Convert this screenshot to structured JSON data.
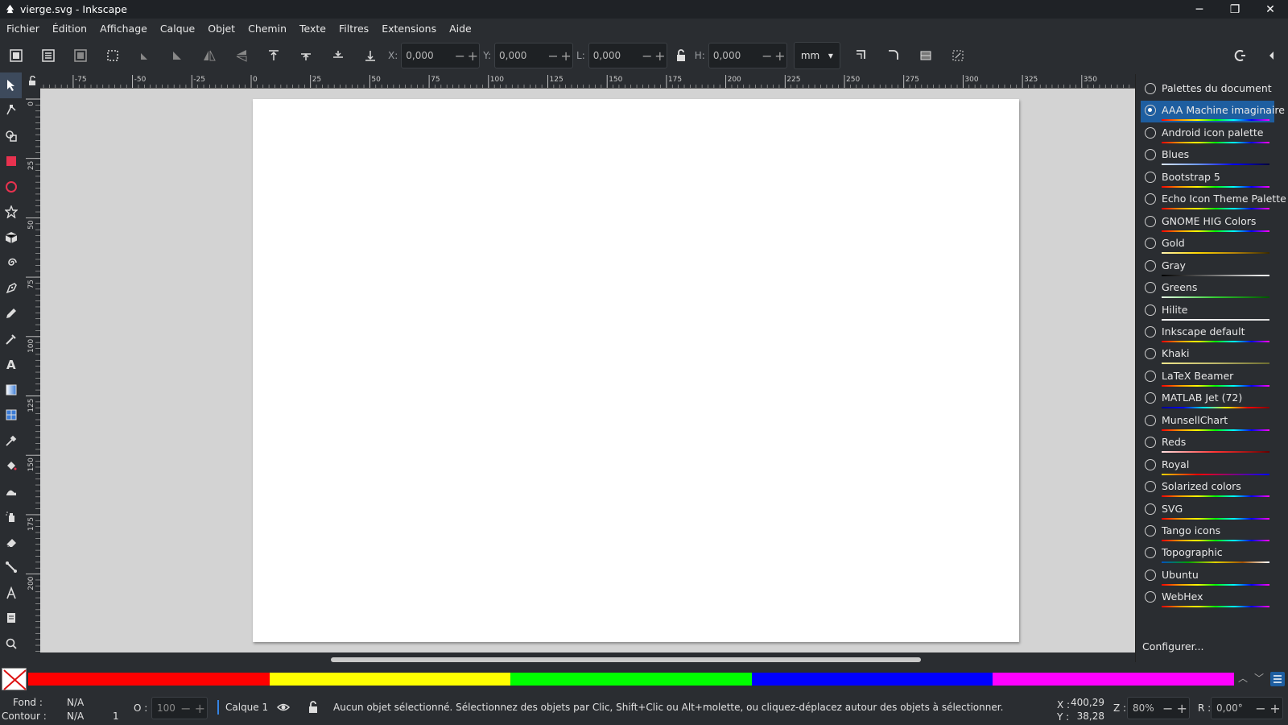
{
  "window": {
    "title": "vierge.svg - Inkscape"
  },
  "menu": [
    "Fichier",
    "Édition",
    "Affichage",
    "Calque",
    "Objet",
    "Chemin",
    "Texte",
    "Filtres",
    "Extensions",
    "Aide"
  ],
  "toolbar": {
    "x_label": "X:",
    "x_value": "0,000",
    "y_label": "Y:",
    "y_value": "0,000",
    "w_label": "L:",
    "w_value": "0,000",
    "h_label": "H:",
    "h_value": "0,000",
    "unit": "mm"
  },
  "rulers": {
    "top_ticks": [
      "-75",
      "-50",
      "-25",
      "0",
      "25",
      "50",
      "75",
      "100",
      "125",
      "150",
      "175",
      "200",
      "225",
      "250",
      "275",
      "300",
      "325",
      "350"
    ],
    "left_ticks": [
      "0",
      "25",
      "50",
      "75",
      "100",
      "125",
      "150",
      "175",
      "200"
    ]
  },
  "palettes": {
    "items": [
      {
        "name": "Palettes du document",
        "selected": false,
        "swatch": "none"
      },
      {
        "name": "AAA Machine imaginaire",
        "selected": true,
        "swatch": "rainbow"
      },
      {
        "name": "Android icon palette",
        "selected": false,
        "swatch": "rainbow"
      },
      {
        "name": "Blues",
        "selected": false,
        "swatch": "blues"
      },
      {
        "name": "Bootstrap 5",
        "selected": false,
        "swatch": "rainbow"
      },
      {
        "name": "Echo Icon Theme Palette",
        "selected": false,
        "swatch": "rainbow"
      },
      {
        "name": "GNOME HIG Colors",
        "selected": false,
        "swatch": "rainbow"
      },
      {
        "name": "Gold",
        "selected": false,
        "swatch": "gold"
      },
      {
        "name": "Gray",
        "selected": false,
        "swatch": "gray"
      },
      {
        "name": "Greens",
        "selected": false,
        "swatch": "greens"
      },
      {
        "name": "Hilite",
        "selected": false,
        "swatch": "hilite"
      },
      {
        "name": "Inkscape default",
        "selected": false,
        "swatch": "rainbow"
      },
      {
        "name": "Khaki",
        "selected": false,
        "swatch": "khaki"
      },
      {
        "name": "LaTeX Beamer",
        "selected": false,
        "swatch": "rainbow"
      },
      {
        "name": "MATLAB Jet (72)",
        "selected": false,
        "swatch": "jet"
      },
      {
        "name": "MunsellChart",
        "selected": false,
        "swatch": "rainbow"
      },
      {
        "name": "Reds",
        "selected": false,
        "swatch": "reds"
      },
      {
        "name": "Royal",
        "selected": false,
        "swatch": "royal"
      },
      {
        "name": "Solarized colors",
        "selected": false,
        "swatch": "rainbow"
      },
      {
        "name": "SVG",
        "selected": false,
        "swatch": "rainbow"
      },
      {
        "name": "Tango icons",
        "selected": false,
        "swatch": "rainbow"
      },
      {
        "name": "Topographic",
        "selected": false,
        "swatch": "topo"
      },
      {
        "name": "Ubuntu",
        "selected": false,
        "swatch": "rainbow"
      },
      {
        "name": "WebHex",
        "selected": false,
        "swatch": "rainbow"
      }
    ],
    "configure_label": "Configurer..."
  },
  "colorbar": {
    "bands": [
      "#ff0000",
      "#ffff00",
      "#00ff00",
      "#0000ff",
      "#ff00ff"
    ]
  },
  "status": {
    "fill_label": "Fond :",
    "fill_value": "N/A",
    "stroke_label": "Contour :",
    "stroke_value": "N/A",
    "stroke_width": "1",
    "opacity_label": "O :",
    "opacity_value": "100",
    "layer_name": "Calque 1",
    "message": "Aucun objet sélectionné. Sélectionnez des objets par Clic, Shift+Clic ou Alt+molette, ou cliquez-déplacez autour des objets à sélectionner.",
    "cursor_x_label": "X :",
    "cursor_x": "400,29",
    "cursor_y_label": "Y :",
    "cursor_y": "38,28",
    "zoom_label": "Z :",
    "zoom_value": "80%",
    "rotation_label": "R :",
    "rotation_value": "0,00°"
  },
  "colors": {
    "accent": "#1e5ea0",
    "panel_bg": "#2a2d31",
    "canvas_bg": "#d3d3d3",
    "page_bg": "#ffffff"
  }
}
